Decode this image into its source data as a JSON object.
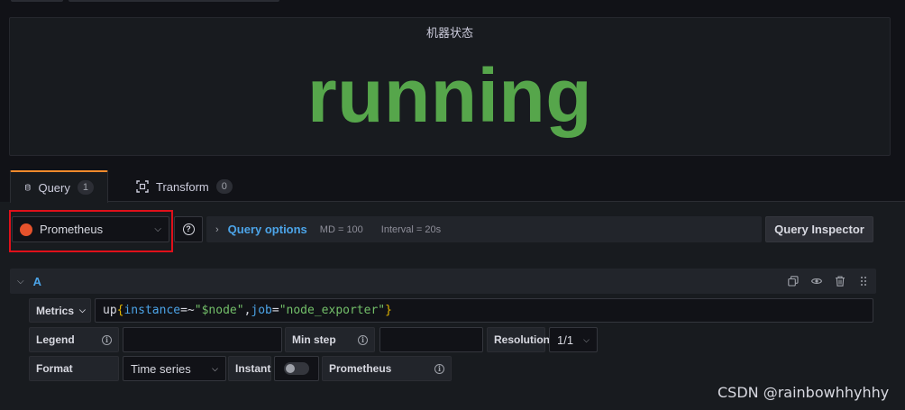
{
  "panel": {
    "title": "机器状态",
    "value": "running",
    "value_color": "#56a64b"
  },
  "tabs": [
    {
      "label": "Query",
      "count": "1",
      "icon": "database-icon",
      "active": true
    },
    {
      "label": "Transform",
      "count": "0",
      "icon": "transform-icon",
      "active": false
    }
  ],
  "datasource": {
    "name": "Prometheus",
    "icon": "prometheus-icon"
  },
  "query_options": {
    "label": "Query options",
    "md": "MD = 100",
    "interval": "Interval = 20s"
  },
  "inspector_label": "Query Inspector",
  "query_row": {
    "name": "A"
  },
  "editor": {
    "metrics_label": "Metrics",
    "metrics_expr": {
      "metric": "up",
      "open": "{",
      "label1": "instance",
      "op1": "=~",
      "value1": "\"$node\"",
      "comma": ",",
      "label2": "job",
      "op2": "=",
      "value2": "\"node_exporter\"",
      "close": "}"
    },
    "legend_label": "Legend",
    "legend_value": "",
    "min_step_label": "Min step",
    "min_step_value": "",
    "resolution_label": "Resolution",
    "resolution_value": "1/1",
    "format_label": "Format",
    "format_value": "Time series",
    "instant_label": "Instant",
    "instant_on": false,
    "datasource_tag": "Prometheus"
  },
  "watermark": "CSDN @rainbowhhyhhy",
  "colors": {
    "accent_blue": "#4ca4e8",
    "active_tab": "#f08a2c",
    "highlight": "#e0101a"
  }
}
